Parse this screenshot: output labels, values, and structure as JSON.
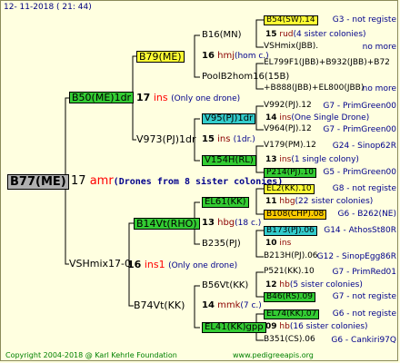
{
  "header": {
    "date": "12- 11-2018 ( 21: 44)"
  },
  "footer": {
    "copyright": "Copyright 2004-2018 @ Karl Kehrle Foundation",
    "url": "www.pedigreeapis.org"
  },
  "root": {
    "name": "B77(ME)",
    "gen": "17",
    "gen_suffix": "amr",
    "note": "(Drones from 8 sister colonies)"
  },
  "sire": {
    "name": "B50(ME)1dr",
    "gen": "17",
    "gen_suffix": "ins",
    "note": "(Only one drone)"
  },
  "dam": {
    "name": "VSHmix17-0",
    "gen": "16",
    "gen_suffix": "ins1",
    "note": "(Only one drone)"
  },
  "gen2": [
    {
      "name": "B79(ME)",
      "gen": "16",
      "gen_suffix": "hmj",
      "note": "(hom c.)"
    },
    {
      "name": "V973(PJ)1dr",
      "gen": "15",
      "gen_suffix": "ins",
      "note": "(1dr.)"
    },
    {
      "name": "B14Vt(RHO)",
      "gen": "13",
      "gen_suffix": "hbg",
      "note": "(18 c.)"
    },
    {
      "name": "B74Vt(KK)",
      "gen": "14",
      "gen_suffix": "mmk",
      "note": "(7 c.)"
    }
  ],
  "gen3": [
    {
      "name": "B16(MN)",
      "gen": "15",
      "gen_suffix": "rud",
      "note": "(4 sister colonies)"
    },
    {
      "name": "PoolB2hom16(15B)"
    },
    {
      "name": "V95(PJ)1dr",
      "gen": "14",
      "gen_suffix": "ins",
      "note": "(One Single Drone)"
    },
    {
      "name": "V154H(RL)",
      "gen": "13",
      "gen_suffix": "ins",
      "note": "(1 single colony)"
    },
    {
      "name": "EL61(KK)",
      "gen": "11",
      "gen_suffix": "hbg",
      "note": "(22 sister colonies)"
    },
    {
      "name": "B235(PJ)",
      "gen": "10",
      "gen_suffix": "ins"
    },
    {
      "name": "B56Vt(KK)",
      "gen": "12",
      "gen_suffix": "hb",
      "note": "(5 sister colonies)"
    },
    {
      "name": "EL41(KK)gpp",
      "gen": "09",
      "gen_suffix": "hb",
      "note": "(16 sister colonies)"
    }
  ],
  "gen4": [
    {
      "name": "B54(SW).14",
      "tail": "G3 - not registe"
    },
    {
      "name": "VSHmix(JBB).",
      "tail": "no more"
    },
    {
      "name": "EL799F1(JBB)+B932(JBB)+B72",
      "tail": ""
    },
    {
      "name": "+B888(JBB)+EL800(JBB)",
      "tail": "no more"
    },
    {
      "name": "V992(PJ).12",
      "tail": "G7 - PrimGreen00"
    },
    {
      "name": "V964(PJ).12",
      "tail": "G7 - PrimGreen00"
    },
    {
      "name": "V179(PM).12",
      "tail": "G24 - Sinop62R"
    },
    {
      "name": "P214(PJ).10",
      "tail": "G5 - PrimGreen00"
    },
    {
      "name": "EL2(KK).10",
      "tail": "G8 - not registe"
    },
    {
      "name": "B108(CHP).08",
      "tail": "G6 - B262(NE)"
    },
    {
      "name": "B173(PJ).06",
      "tail": "G14 - AthosSt80R"
    },
    {
      "name": "B213H(PJ).06",
      "tail": "G12 - SinopEgg86R"
    },
    {
      "name": "P521(KK).10",
      "tail": "G7 - PrimRed01"
    },
    {
      "name": "B46(RS).09",
      "tail": "G7 - not registe"
    },
    {
      "name": "EL74(KK).07",
      "tail": "G6 - not registe"
    },
    {
      "name": "B351(CS).06",
      "tail": "G6 - Cankiri97Q"
    }
  ]
}
